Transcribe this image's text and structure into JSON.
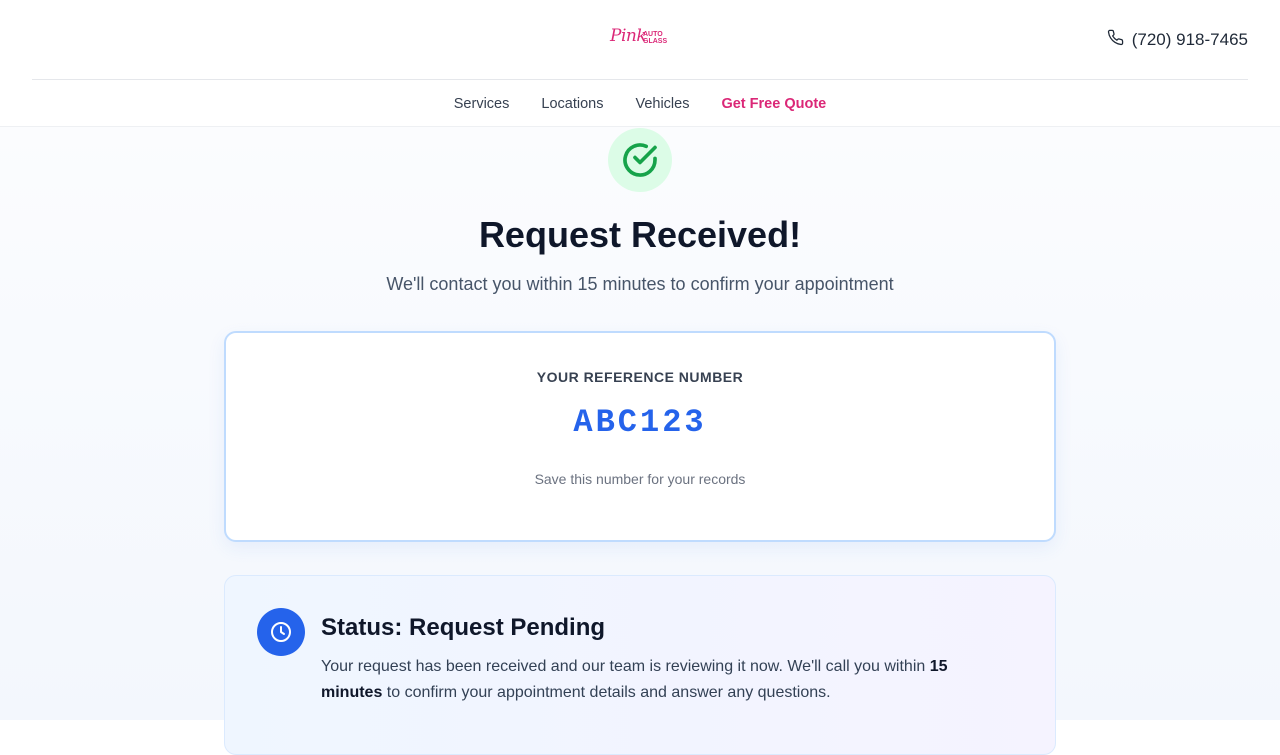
{
  "brand": {
    "logo_script": "Pink",
    "logo_sub_top": "AUTO",
    "logo_sub_bottom": "GLASS",
    "accent_color": "#db2777"
  },
  "header": {
    "phone_icon": "phone-icon",
    "phone_number": "(720) 918-7465"
  },
  "nav": {
    "items": [
      {
        "label": "Services"
      },
      {
        "label": "Locations"
      },
      {
        "label": "Vehicles"
      },
      {
        "label": "Get Free Quote"
      }
    ]
  },
  "confirmation": {
    "icon": "check-circle-icon",
    "success_color": "#16a34a",
    "title": "Request Received!",
    "subtitle": "We'll contact you within 15 minutes to confirm your appointment"
  },
  "reference": {
    "label": "YOUR REFERENCE NUMBER",
    "number": "ABC123",
    "note": "Save this number for your records",
    "number_color": "#2563eb"
  },
  "status": {
    "icon": "clock-icon",
    "title": "Status: Request Pending",
    "body_before": "Your request has been received and our team is reviewing it now. We'll call you within ",
    "body_bold": "15 minutes",
    "body_after": " to confirm your appointment details and answer any questions."
  }
}
